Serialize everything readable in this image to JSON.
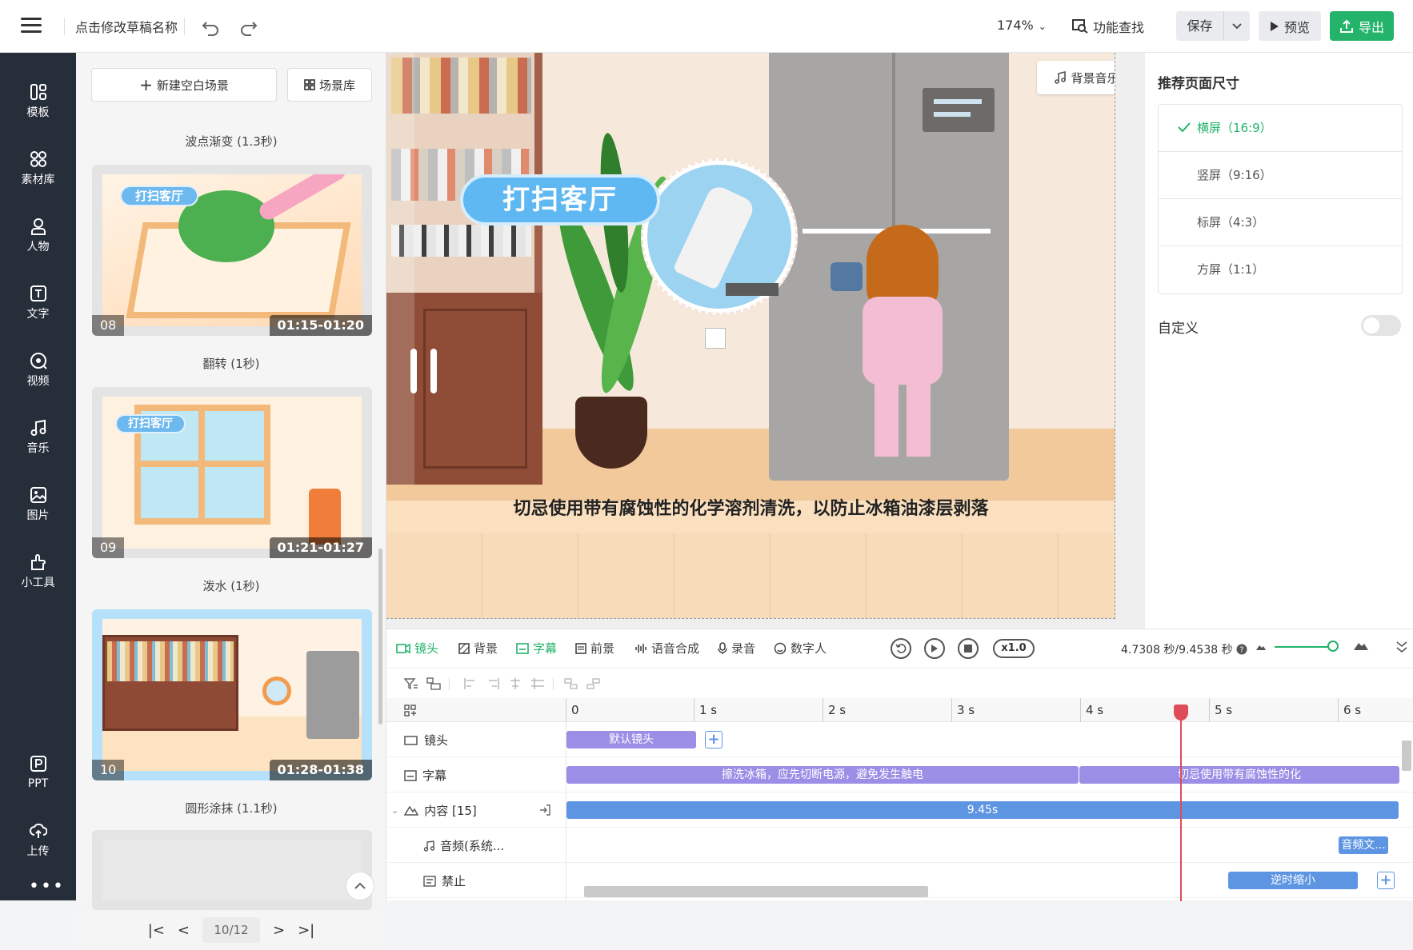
{
  "header": {
    "draft_name": "点击修改草稿名称",
    "zoom": "174%",
    "feature_search": "功能查找",
    "save": "保存",
    "preview": "预览",
    "export": "导出"
  },
  "sidebar": {
    "items": [
      {
        "label": "模板",
        "icon": "template-icon"
      },
      {
        "label": "素材库",
        "icon": "material-icon"
      },
      {
        "label": "人物",
        "icon": "person-icon"
      },
      {
        "label": "文字",
        "icon": "text-icon"
      },
      {
        "label": "视频",
        "icon": "video-icon"
      },
      {
        "label": "音乐",
        "icon": "music-icon"
      },
      {
        "label": "图片",
        "icon": "image-icon"
      },
      {
        "label": "小工具",
        "icon": "tool-icon"
      },
      {
        "label": "PPT",
        "icon": "ppt-icon"
      },
      {
        "label": "上传",
        "icon": "upload-icon"
      }
    ]
  },
  "scene_panel": {
    "new_blank": "新建空白场景",
    "library": "场景库",
    "transitions": [
      "波点渐变 (1.3秒)",
      "翻转 (1秒)",
      "泼水 (1秒)",
      "圆形涂抹 (1.1秒)"
    ],
    "scenes": [
      {
        "num": "08",
        "time": "01:15-01:20",
        "banner": "打扫客厅"
      },
      {
        "num": "09",
        "time": "01:21-01:27",
        "banner": "打扫客厅"
      },
      {
        "num": "10",
        "time": "01:28-01:38",
        "banner": "打扫客厅"
      }
    ],
    "page": "10/12"
  },
  "canvas": {
    "bgm": "背景音乐",
    "banner": "打扫客厅",
    "subtitle": "切忌使用带有腐蚀性的化学溶剂清洗，以防止冰箱油漆层剥落"
  },
  "right_panel": {
    "title": "推荐页面尺寸",
    "sizes": [
      "横屏（16:9）",
      "竖屏（9:16）",
      "标屏（4:3）",
      "方屏（1:1）"
    ],
    "selected_size": "横屏（16:9）",
    "custom": "自定义",
    "custom_enabled": false
  },
  "timeline": {
    "tabs": [
      "镜头",
      "背景",
      "字幕",
      "前景",
      "语音合成",
      "录音",
      "数字人"
    ],
    "speed": "x1.0",
    "time": "4.7308 秒/9.4538 秒",
    "ruler": [
      "0",
      "1 s",
      "2 s",
      "3 s",
      "4 s",
      "5 s",
      "6 s"
    ],
    "rows": {
      "camera": {
        "label": "镜头",
        "clip": "默认镜头"
      },
      "subtitle": {
        "label": "字幕",
        "clip1": "擦洗冰箱，应先切断电源，避免发生触电",
        "clip2": "切忌使用带有腐蚀性的化"
      },
      "content": {
        "label": "内容 [15]",
        "clip": "9.45s"
      },
      "audio": {
        "label": "音频(系统...",
        "clip": "音频文..."
      },
      "forbid": {
        "label": "禁止",
        "clip": "逆时缩小"
      }
    }
  },
  "colors": {
    "accent_green": "#23b36a",
    "sidebar_bg": "#262e3a",
    "clip_purple": "#9b8ee6",
    "clip_blue": "#5d95e3",
    "playhead": "#e04b5a"
  }
}
